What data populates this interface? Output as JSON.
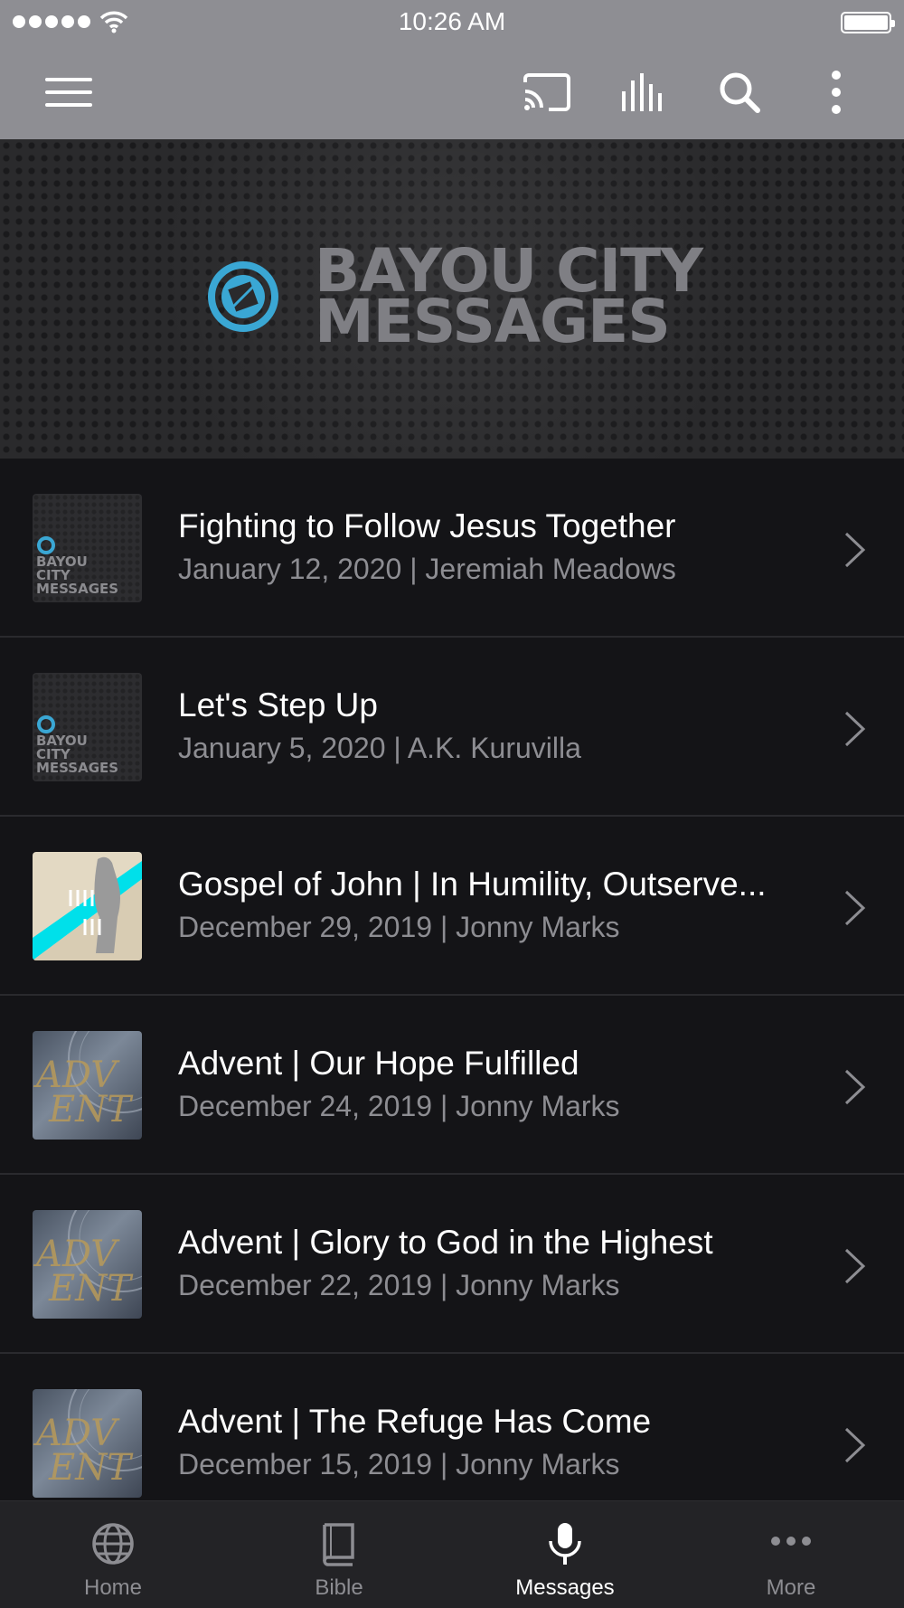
{
  "status_bar": {
    "time": "10:26 AM",
    "icons": [
      "signal-icon",
      "wifi-icon",
      "battery-icon"
    ]
  },
  "toolbar": {
    "icons": [
      "menu-icon",
      "cast-icon",
      "equalizer-icon",
      "search-icon",
      "more-vertical-icon"
    ]
  },
  "banner": {
    "title_line1": "BAYOU CITY",
    "title_line2": "MESSAGES",
    "accent_color": "#3aa7d4"
  },
  "messages": [
    {
      "title": "Fighting to Follow Jesus Together",
      "subtitle": "January 12, 2020 | Jeremiah Meadows",
      "thumb_text": [
        "BAYOU",
        "CITY",
        "MESSAGES"
      ]
    },
    {
      "title": "Let's Step Up",
      "subtitle": "January 5, 2020 | A.K. Kuruvilla",
      "thumb_text": [
        "BAYOU",
        "CITY",
        "MESSAGES"
      ]
    },
    {
      "title": "Gospel of John | In Humility, Outserve...",
      "subtitle": "December 29, 2019 | Jonny Marks"
    },
    {
      "title": "Advent | Our Hope Fulfilled",
      "subtitle": "December 24, 2019 | Jonny Marks"
    },
    {
      "title": "Advent | Glory to God in the Highest",
      "subtitle": "December 22, 2019 | Jonny Marks"
    },
    {
      "title": "Advent | The Refuge Has Come",
      "subtitle": "December 15, 2019 | Jonny Marks"
    }
  ],
  "tabs": [
    {
      "label": "Home",
      "icon": "globe-icon",
      "active": false
    },
    {
      "label": "Bible",
      "icon": "book-icon",
      "active": false
    },
    {
      "label": "Messages",
      "icon": "microphone-icon",
      "active": true
    },
    {
      "label": "More",
      "icon": "more-horizontal-icon",
      "active": false
    }
  ]
}
